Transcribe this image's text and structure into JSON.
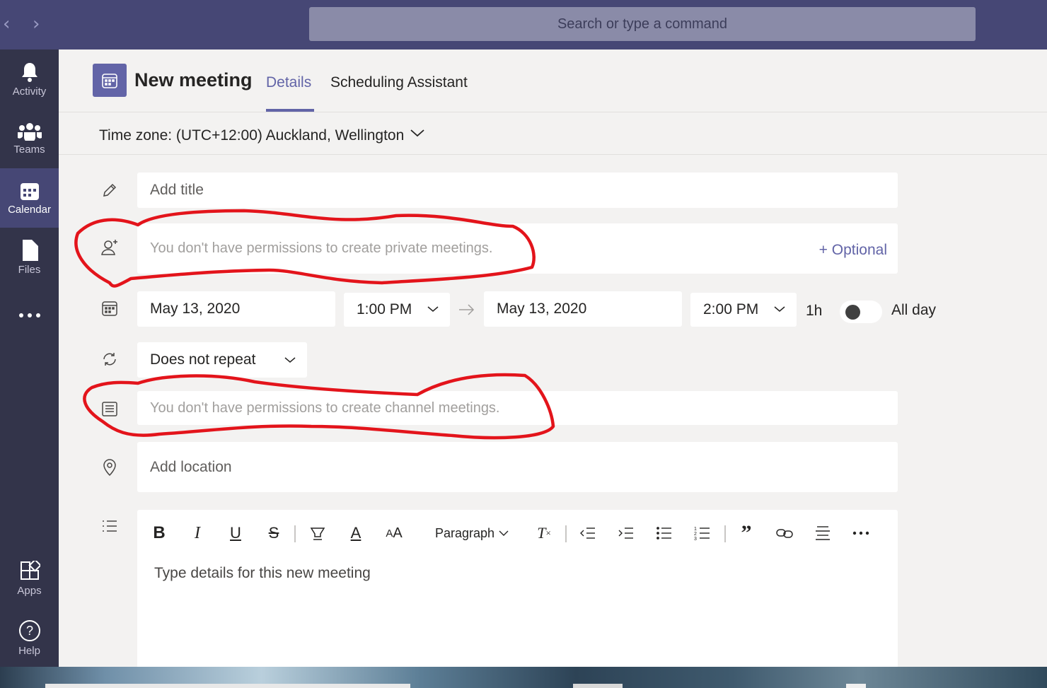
{
  "search": {
    "placeholder": "Search or type a command"
  },
  "nav": {
    "back_icon": "chevron-left-icon",
    "forward_icon": "chevron-right-icon"
  },
  "rail": {
    "items": [
      {
        "label": "Activity",
        "icon": "bell-icon"
      },
      {
        "label": "Teams",
        "icon": "teams-icon"
      },
      {
        "label": "Calendar",
        "icon": "calendar-icon",
        "active": true
      },
      {
        "label": "Files",
        "icon": "file-icon"
      },
      {
        "label": "",
        "icon": "more-icon"
      },
      {
        "label": "Apps",
        "icon": "apps-icon"
      },
      {
        "label": "Help",
        "icon": "help-icon"
      }
    ]
  },
  "header": {
    "title": "New meeting",
    "tabs": [
      {
        "label": "Details",
        "active": true
      },
      {
        "label": "Scheduling Assistant",
        "active": false
      }
    ]
  },
  "timezone": {
    "label": "Time zone: (UTC+12:00) Auckland, Wellington"
  },
  "form": {
    "title_placeholder": "Add title",
    "attendees_text": "You don't have permissions to create private meetings.",
    "optional_label": "+ Optional",
    "start_date": "May 13, 2020",
    "start_time": "1:00 PM",
    "end_date": "May 13, 2020",
    "end_time": "2:00 PM",
    "duration": "1h",
    "all_day_label": "All day",
    "all_day_on": false,
    "repeat": "Does not repeat",
    "channel_text": "You don't have permissions to create channel meetings.",
    "location_placeholder": "Add location"
  },
  "editor": {
    "paragraph_label": "Paragraph",
    "placeholder": "Type details for this new meeting",
    "toolbar": [
      "bold-icon",
      "italic-icon",
      "underline-icon",
      "strikethrough-icon",
      "highlight-icon",
      "font-color-icon",
      "font-size-icon",
      "clear-format-icon",
      "decrease-indent-icon",
      "increase-indent-icon",
      "bullet-list-icon",
      "numbered-list-icon",
      "quote-icon",
      "link-icon",
      "align-icon",
      "more-icon"
    ]
  },
  "colors": {
    "brand": "#6264a7",
    "rail": "#33344a",
    "topbar": "#464775",
    "annotation": "#e3141b"
  }
}
